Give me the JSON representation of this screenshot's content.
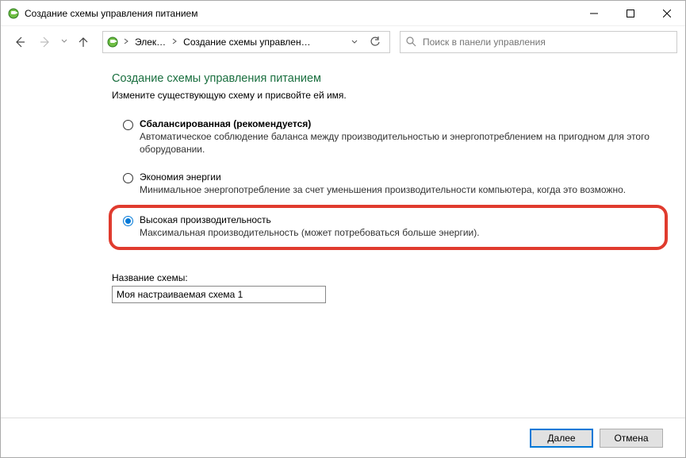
{
  "window": {
    "title": "Создание схемы управления питанием"
  },
  "breadcrumb": {
    "item1": "Элек…",
    "item2": "Создание схемы управлен…"
  },
  "search": {
    "placeholder": "Поиск в панели управления"
  },
  "page": {
    "heading": "Создание схемы управления питанием",
    "subtitle": "Измените существующую схему и присвойте ей имя."
  },
  "options": {
    "balanced": {
      "title": "Сбалансированная (рекомендуется)",
      "desc": "Автоматическое соблюдение баланса между производительностью и энергопотреблением на пригодном для этого оборудовании."
    },
    "saver": {
      "title": "Экономия энергии",
      "desc": "Минимальное энергопотребление за счет уменьшения производительности компьютера, когда это возможно."
    },
    "high": {
      "title": "Высокая производительность",
      "desc": "Максимальная производительность (может потребоваться больше энергии)."
    }
  },
  "name_field": {
    "label": "Название схемы:",
    "value": "Моя настраиваемая схема 1"
  },
  "buttons": {
    "next": "Далее",
    "cancel": "Отмена"
  }
}
